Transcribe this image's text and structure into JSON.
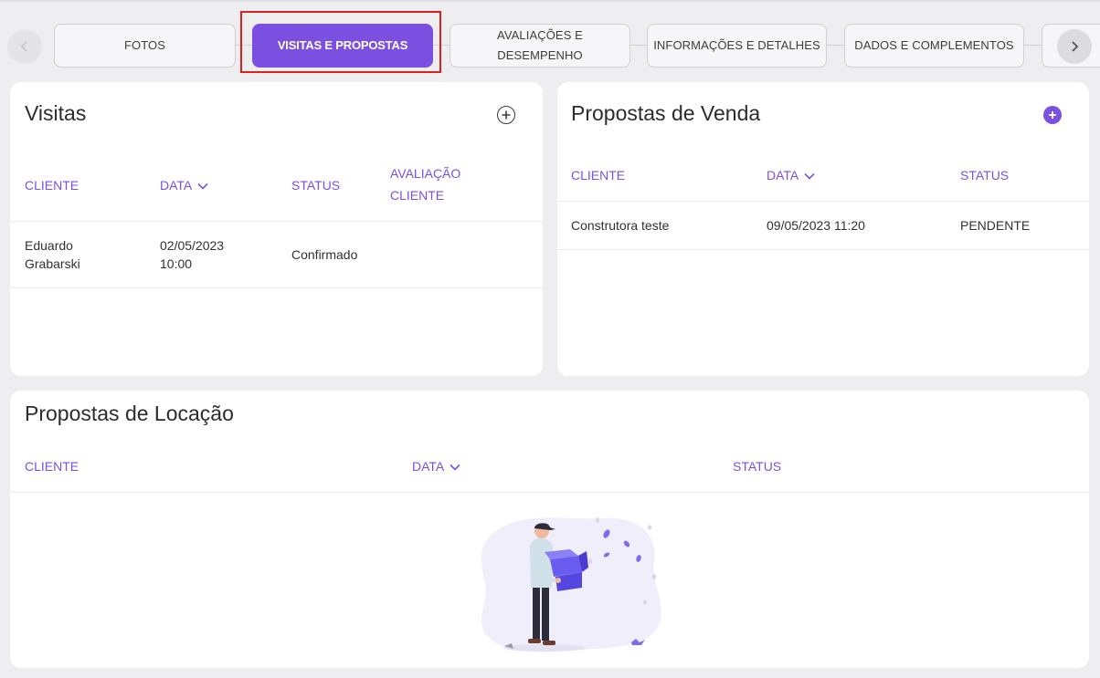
{
  "tabs": [
    {
      "label": "FOTOS"
    },
    {
      "label": "VISITAS E PROPOSTAS",
      "active": true
    },
    {
      "label": "AVALIAÇÕES E DESEMPENHO"
    },
    {
      "label": "INFORMAÇÕES E DETALHES"
    },
    {
      "label": "DADOS E COMPLEMENTOS"
    }
  ],
  "nav": {
    "prev_icon": "chevron-left-icon",
    "next_icon": "chevron-right-icon"
  },
  "visitas": {
    "title": "Visitas",
    "add_icon": "plus-circle-outline-icon",
    "columns": {
      "cliente": "CLIENTE",
      "data": "DATA",
      "status": "STATUS",
      "avaliacao_line1": "AVALIAÇÃO",
      "avaliacao_line2": "CLIENTE"
    },
    "rows": [
      {
        "cliente_line1": "Eduardo",
        "cliente_line2": "Grabarski",
        "data_line1": "02/05/2023",
        "data_line2": "10:00",
        "status": "Confirmado",
        "avaliacao": ""
      }
    ]
  },
  "venda": {
    "title": "Propostas de Venda",
    "add_icon": "plus-circle-filled-icon",
    "columns": {
      "cliente": "CLIENTE",
      "data": "DATA",
      "status": "STATUS"
    },
    "rows": [
      {
        "cliente": "Construtora teste",
        "data": "09/05/2023 11:20",
        "status": "PENDENTE"
      }
    ]
  },
  "locacao": {
    "title": "Propostas de Locação",
    "columns": {
      "cliente": "CLIENTE",
      "data": "DATA",
      "status": "STATUS"
    },
    "empty_illustration": "empty-box-illustration"
  },
  "colors": {
    "accent": "#7b4fe0",
    "background": "#eeeef1",
    "highlight": "#e02020"
  }
}
